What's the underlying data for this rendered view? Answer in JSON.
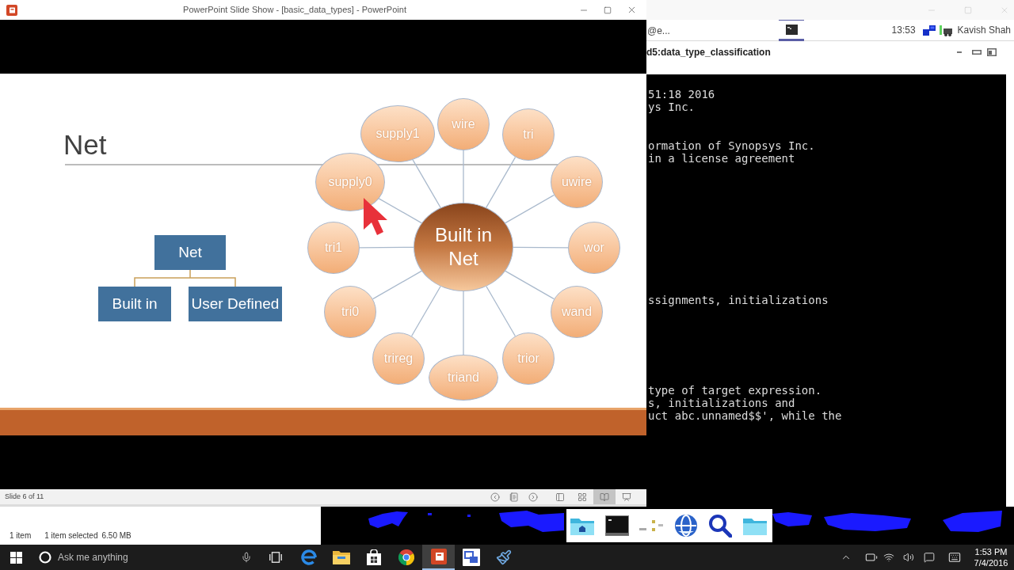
{
  "powerpoint": {
    "title": "PowerPoint Slide Show - [basic_data_types] - PowerPoint",
    "slide": {
      "title": "Net",
      "tree": {
        "label": "Net",
        "children": [
          {
            "label": "Built in"
          },
          {
            "label": "User Defined"
          }
        ]
      },
      "wheel": {
        "label": "Built in Net",
        "children": [
          {
            "label": "wire"
          },
          {
            "label": "tri"
          },
          {
            "label": "uwire"
          },
          {
            "label": "wor"
          },
          {
            "label": "wand"
          },
          {
            "label": "trior"
          },
          {
            "label": "triand"
          },
          {
            "label": "trireg"
          },
          {
            "label": "tri0"
          },
          {
            "label": "tri1"
          },
          {
            "label": "supply0"
          },
          {
            "label": "supply1"
          }
        ]
      }
    },
    "status_bar": {
      "slide_counter": "Slide 6 of 11",
      "view_buttons": [
        {
          "selected": false
        },
        {
          "selected": false
        },
        {
          "selected": true
        },
        {
          "selected": false
        }
      ]
    }
  },
  "desktop_panel": {
    "task_label": "@e...",
    "panel_tabs": [
      {
        "selected": true
      }
    ],
    "clock": "13:53",
    "user": "Kavish Shah"
  },
  "terminal": {
    "title": "d5:data_type_classification",
    "blocks": [
      [
        "51:18 2016",
        "ys Inc."
      ],
      [
        "ormation of Synopsys Inc.",
        "in a license agreement"
      ],
      [
        "ssignments, initializations"
      ],
      [
        "type of target expression.",
        "s, initializations and",
        "uct abc.unnamed$$', while the"
      ]
    ]
  },
  "file_explorer_status": {
    "item_count": "1 item",
    "selection": "1 item selected",
    "size": "6.50 MB"
  },
  "taskbar": {
    "search": {
      "placeholder": "Ask me anything"
    },
    "apps": [
      {
        "selected": false
      },
      {
        "selected": false
      },
      {
        "selected": false
      },
      {
        "selected": false
      },
      {
        "selected": true
      },
      {
        "selected": false
      },
      {
        "selected": false
      }
    ],
    "clock": {
      "time": "1:53 PM",
      "date": "7/4/2016"
    }
  }
}
